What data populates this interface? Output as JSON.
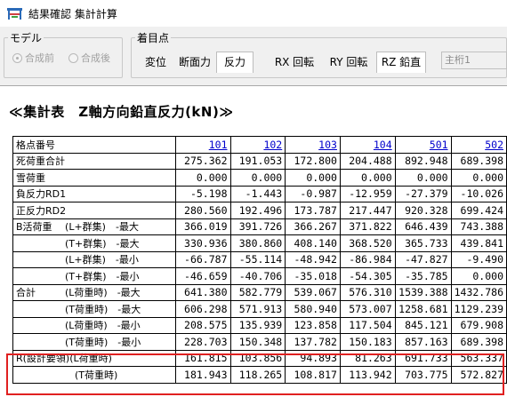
{
  "window": {
    "title": "結果確認 集計計算"
  },
  "model_group": {
    "legend": "モデル",
    "options": [
      {
        "label": "合成前",
        "selected": true
      },
      {
        "label": "合成後",
        "selected": false
      }
    ]
  },
  "focus_group": {
    "legend": "着目点",
    "buttons": [
      {
        "label": "変位",
        "active": false
      },
      {
        "label": "断面力",
        "active": false
      },
      {
        "label": "反力",
        "active": true
      },
      {
        "label": "RX 回転",
        "active": false
      },
      {
        "label": "RY 回転",
        "active": false
      },
      {
        "label": "RZ 鉛直",
        "active": true
      }
    ]
  },
  "girder_select": {
    "value": "主桁1"
  },
  "report": {
    "title": "≪集計表　Z軸方向鉛直反力(kN)≫",
    "corner": "格点番号",
    "columns": [
      "101",
      "102",
      "103",
      "104",
      "501",
      "502"
    ],
    "rows": [
      {
        "label": "死荷重合計",
        "values": [
          "275.362",
          "191.053",
          "172.800",
          "204.488",
          "892.948",
          "689.398"
        ]
      },
      {
        "label": "雪荷重",
        "values": [
          "0.000",
          "0.000",
          "0.000",
          "0.000",
          "0.000",
          "0.000"
        ]
      },
      {
        "label": "負反力RD1",
        "values": [
          "-5.198",
          "-1.443",
          "-0.987",
          "-12.959",
          "-27.379",
          "-10.026"
        ]
      },
      {
        "label": "正反力RD2",
        "values": [
          "280.560",
          "192.496",
          "173.787",
          "217.447",
          "920.328",
          "699.424"
        ]
      },
      {
        "label": "B活荷重　 (L+群集)　-最大",
        "values": [
          "366.019",
          "391.726",
          "366.267",
          "371.822",
          "646.439",
          "743.388"
        ]
      },
      {
        "label": "　　　　　(T+群集)　-最大",
        "values": [
          "330.936",
          "380.860",
          "408.140",
          "368.520",
          "365.733",
          "439.841"
        ]
      },
      {
        "label": "　　　　　(L+群集)　-最小",
        "values": [
          "-66.787",
          "-55.114",
          "-48.942",
          "-86.984",
          "-47.827",
          "-9.490"
        ]
      },
      {
        "label": "　　　　　(T+群集)　-最小",
        "values": [
          "-46.659",
          "-40.706",
          "-35.018",
          "-54.305",
          "-35.785",
          "0.000"
        ]
      },
      {
        "label": "合計　　　(L荷重時)　-最大",
        "values": [
          "641.380",
          "582.779",
          "539.067",
          "576.310",
          "1539.388",
          "1432.786"
        ]
      },
      {
        "label": "　　　　　(T荷重時)　-最大",
        "values": [
          "606.298",
          "571.913",
          "580.940",
          "573.007",
          "1258.681",
          "1129.239"
        ]
      },
      {
        "label": "　　　　　(L荷重時)　-最小",
        "values": [
          "208.575",
          "135.939",
          "123.858",
          "117.504",
          "845.121",
          "679.908"
        ]
      },
      {
        "label": "　　　　　(T荷重時)　-最小",
        "values": [
          "228.703",
          "150.348",
          "137.782",
          "150.183",
          "857.163",
          "689.398"
        ]
      },
      {
        "label": "R(設計要領)(L荷重時)",
        "values": [
          "161.815",
          "103.856",
          "94.893",
          "81.263",
          "691.733",
          "563.337"
        ]
      },
      {
        "label": "　　　　　　(T荷重時)",
        "values": [
          "181.943",
          "118.265",
          "108.817",
          "113.942",
          "703.775",
          "572.827"
        ]
      }
    ]
  },
  "colors": {
    "highlight": "#e02020",
    "link": "#0000cc"
  }
}
